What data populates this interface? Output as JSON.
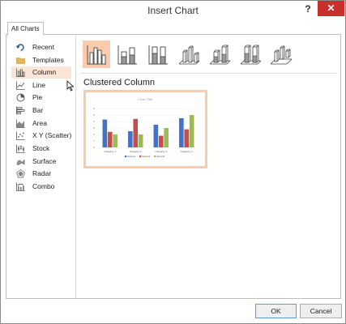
{
  "window": {
    "title": "Insert Chart",
    "help": "?",
    "close": "✕"
  },
  "tabs": [
    {
      "label": "All Charts"
    }
  ],
  "sidebar": {
    "items": [
      {
        "label": "Recent",
        "icon": "recent-icon"
      },
      {
        "label": "Templates",
        "icon": "folder-icon"
      },
      {
        "label": "Column",
        "icon": "column-chart-icon",
        "active": true
      },
      {
        "label": "Line",
        "icon": "line-chart-icon"
      },
      {
        "label": "Pie",
        "icon": "pie-chart-icon"
      },
      {
        "label": "Bar",
        "icon": "bar-chart-icon"
      },
      {
        "label": "Area",
        "icon": "area-chart-icon"
      },
      {
        "label": "X Y (Scatter)",
        "icon": "scatter-chart-icon"
      },
      {
        "label": "Stock",
        "icon": "stock-chart-icon"
      },
      {
        "label": "Surface",
        "icon": "surface-chart-icon"
      },
      {
        "label": "Radar",
        "icon": "radar-chart-icon"
      },
      {
        "label": "Combo",
        "icon": "combo-chart-icon"
      }
    ]
  },
  "subtypes": [
    {
      "name": "clustered-column",
      "selected": true
    },
    {
      "name": "stacked-column"
    },
    {
      "name": "100-stacked-column"
    },
    {
      "name": "3d-clustered-column"
    },
    {
      "name": "3d-stacked-column"
    },
    {
      "name": "3d-100-stacked-column"
    },
    {
      "name": "3d-column"
    }
  ],
  "main": {
    "chart_type_title": "Clustered Column"
  },
  "preview": {
    "title": "Chart Title",
    "categories": [
      "Category 1",
      "Category 2",
      "Category 3",
      "Category 4"
    ],
    "series": [
      {
        "name": "Series1",
        "values": [
          4.3,
          2.5,
          3.5,
          4.5
        ],
        "color": "#4472c4"
      },
      {
        "name": "Series2",
        "values": [
          2.4,
          4.4,
          1.8,
          2.8
        ],
        "color": "#c0504d"
      },
      {
        "name": "Series3",
        "values": [
          2.0,
          2.0,
          3.0,
          5.0
        ],
        "color": "#9bbb59"
      }
    ],
    "yticks": [
      "0",
      "1",
      "2",
      "3",
      "4",
      "5",
      "6"
    ]
  },
  "buttons": {
    "ok": "OK",
    "cancel": "Cancel"
  },
  "colors": {
    "accent_selected": "#f8cbad",
    "nav_active": "#fbe5d6",
    "close_red": "#c7302b"
  }
}
